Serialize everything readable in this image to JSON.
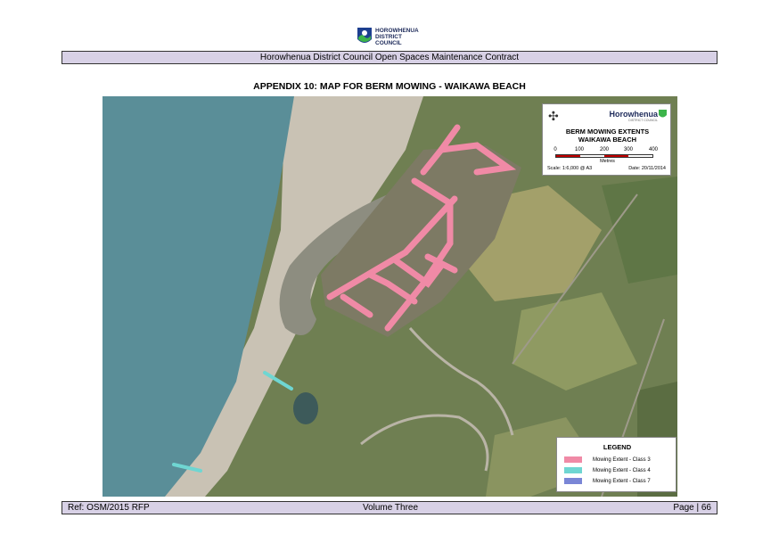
{
  "logo": {
    "lines": [
      "HOROWHENUA",
      "DISTRICT",
      "COUNCIL"
    ]
  },
  "header": {
    "text": "Horowhenua District Council Open Spaces Maintenance Contract"
  },
  "title": "APPENDIX 10:  MAP FOR BERM MOWING - WAIKAWA BEACH",
  "map_box": {
    "brand": "Horowhenua",
    "brand_sub": "DISTRICT COUNCIL",
    "title_line1": "BERM MOWING EXTENTS",
    "title_line2": "WAIKAWA BEACH",
    "scale_ticks": [
      "0",
      "100",
      "200",
      "300",
      "400"
    ],
    "scale_unit": "Metres",
    "scale": "Scale: 1:6,000 @ A3",
    "date": "Date: 20/11/2014"
  },
  "legend": {
    "title": "LEGEND",
    "items": [
      {
        "label": "Mowing Extent - Class 3",
        "color": "#f08aa6"
      },
      {
        "label": "Mowing Extent - Class 4",
        "color": "#6fd6d2"
      },
      {
        "label": "Mowing Extent - Class 7",
        "color": "#7a86d6"
      }
    ]
  },
  "colors": {
    "class3": "#f08aa6",
    "class4": "#6fd6d2",
    "sea": "#5a8e98",
    "sand": "#c9c2b4",
    "land": "#6f7f52",
    "bar": "#d8d1e6"
  },
  "footer": {
    "left": "Ref: OSM/2015 RFP",
    "center": "Volume Three",
    "right": "Page | 66"
  }
}
